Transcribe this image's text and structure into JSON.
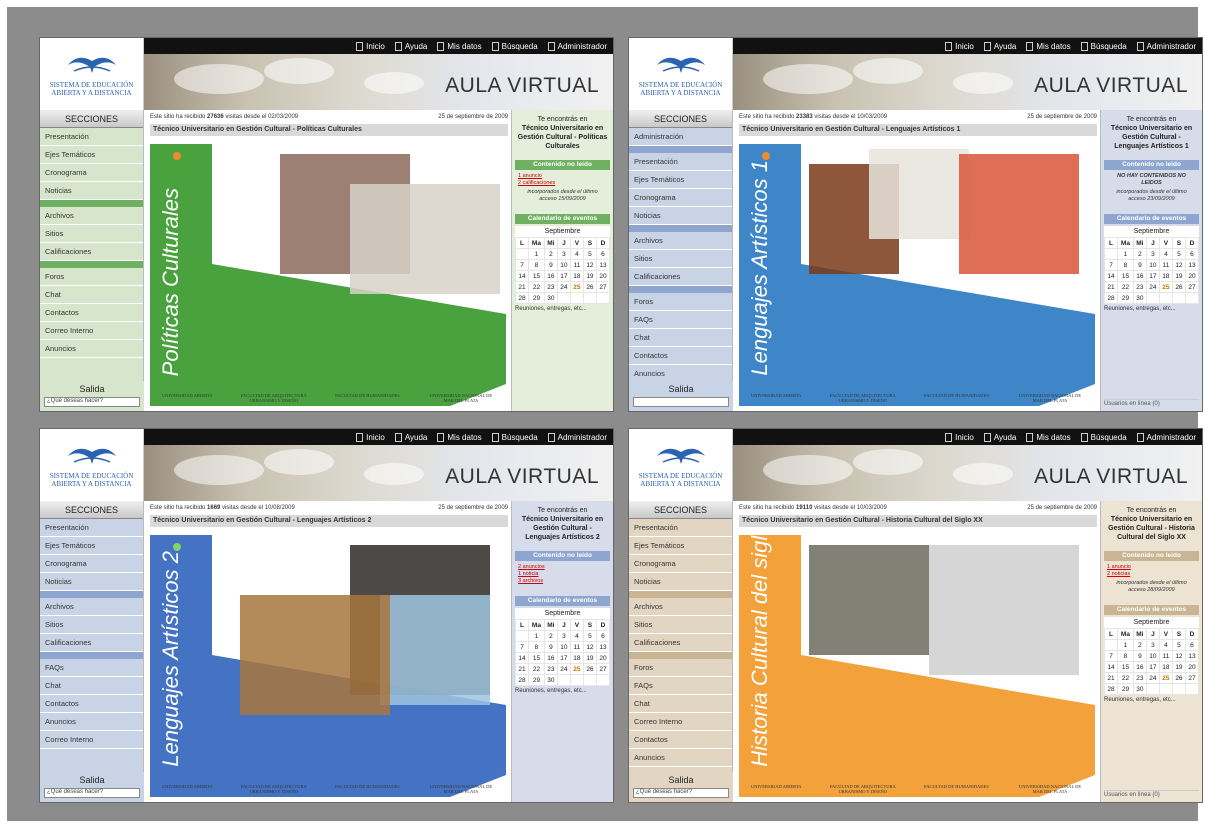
{
  "brand": {
    "logo_text": "SISTEMA DE EDUCACIÓN ABIERTA Y A DISTANCIA"
  },
  "nav": [
    {
      "label": "Inicio",
      "icon": "inicio-icon"
    },
    {
      "label": "Ayuda",
      "icon": "ayuda-icon"
    },
    {
      "label": "Mis datos",
      "icon": "mis-datos-icon"
    },
    {
      "label": "Búsqueda",
      "icon": "busqueda-icon"
    },
    {
      "label": "Administrador",
      "icon": "administrador-icon"
    }
  ],
  "banner_title": "AULA VIRTUAL",
  "partners": [
    "UNIVERSIDAD ABIERTA",
    "FACULTAD DE ARQUITECTURA URBANISMO Y DISEÑO",
    "FACULTAD DE HUMANIDADES",
    "UNIVERSIDAD NACIONAL DE MAR DEL PLATA"
  ],
  "screens": [
    {
      "theme": {
        "side_bg": "#d7e5cc",
        "right_bg": "#e4eedb",
        "accent": "#4aa23f",
        "head": "#6fb062"
      },
      "sections_head": "SECCIONES",
      "menu": [
        "Presentación",
        "Ejes Temáticos",
        "Cronograma",
        "Noticias",
        "|",
        "Archivos",
        "Sitios",
        "Calificaciones",
        "|",
        "Foros",
        "Chat",
        "Contactos",
        "Correo Interno",
        "Anuncios"
      ],
      "salida": "Salida",
      "salida_select": "¿Qué deseas hacer?",
      "visits_pre": "Este sitio ha recibido",
      "visits": "27636",
      "visits_post": "visitas desde el 02/03/2009",
      "date": "25 de septiembre de 2009",
      "crumb": "Técnico Universitario en Gestión Cultural - Políticas Culturales",
      "poster_title": "Políticas Culturales",
      "found_label": "Te encontrás en",
      "found_course": "Técnico Universitario en Gestión Cultural - Políticas Culturales",
      "unread_head": "Contenido no leído",
      "unread_links": [
        "1 anuncio",
        "2 calificaciones"
      ],
      "incorporated": "incorporados desde el último acceso 15/09/2009",
      "cal_head": "Calendario de eventos",
      "month": "Septiembre",
      "note": "Reuniones, entregas, etc...",
      "online": ""
    },
    {
      "theme": {
        "side_bg": "#c9d3e6",
        "right_bg": "#d6dcea",
        "accent": "#3f86c9",
        "head": "#8ea6cf"
      },
      "sections_head": "SECCIONES",
      "menu": [
        "Administración",
        "|",
        "Presentación",
        "Ejes Temáticos",
        "Cronograma",
        "Noticias",
        "|",
        "Archivos",
        "Sitios",
        "Calificaciones",
        "|",
        "Foros",
        "FAQs",
        "Chat",
        "Contactos",
        "Anuncios",
        "Correo Interno"
      ],
      "salida": "Salida",
      "salida_select": "",
      "visits_pre": "Este sitio ha recibido",
      "visits": "23383",
      "visits_post": "visitas desde el 10/03/2009",
      "date": "25 de septiembre de 2009",
      "crumb": "Técnico Universitario en Gestión Cultural - Lenguajes Artísticos 1",
      "poster_title": "Lenguajes Artísticos 1",
      "found_label": "Te encontrás en",
      "found_course": "Técnico Universitario en Gestión Cultural - Lenguajes Artísticos 1",
      "unread_head": "Contenido no leído",
      "unread_links": [],
      "unread_none": "NO HAY CONTENIDOS NO LEIDOS",
      "incorporated": "incorporados desde el último acceso 23/09/2009",
      "cal_head": "Calendario de eventos",
      "month": "Septiembre",
      "note": "Reuniones, entregas, etc...",
      "online": "Usuarios en línea (0)"
    },
    {
      "theme": {
        "side_bg": "#c9d3e6",
        "right_bg": "#d6dcea",
        "accent": "#4473c4",
        "head": "#8ea6cf"
      },
      "sections_head": "SECCIONES",
      "menu": [
        "Presentación",
        "Ejes Temáticos",
        "Cronograma",
        "Noticias",
        "|",
        "Archivos",
        "Sitios",
        "Calificaciones",
        "|",
        "FAQs",
        "Chat",
        "Contactos",
        "Anuncios",
        "Correo Interno"
      ],
      "salida": "Salida",
      "salida_select": "¿Qué deseas hacer?",
      "visits_pre": "Este sitio ha recibido",
      "visits": "1669",
      "visits_post": "visitas desde el 10/08/2009",
      "date": "25 de septiembre de 2009",
      "crumb": "Técnico Universitario en Gestión Cultural - Lenguajes Artísticos 2",
      "poster_title": "Lenguajes Artísticos 2",
      "found_label": "Te encontrás en",
      "found_course": "Técnico Universitario en Gestión Cultural - Lenguajes Artísticos 2",
      "unread_head": "Contenido no leído",
      "unread_links": [
        "2 anuncios",
        "1 noticia",
        "3 archivos"
      ],
      "incorporated": "",
      "cal_head": "Calendario de eventos",
      "month": "Septiembre",
      "note": "Reuniones, entregas, etc...",
      "online": ""
    },
    {
      "theme": {
        "side_bg": "#e2d6c2",
        "right_bg": "#ece3d3",
        "accent": "#f2a13b",
        "head": "#c9b493"
      },
      "sections_head": "SECCIONES",
      "menu": [
        "Presentación",
        "Ejes Temáticos",
        "Cronograma",
        "Noticias",
        "|",
        "Archivos",
        "Sitios",
        "Calificaciones",
        "|",
        "Foros",
        "FAQs",
        "Chat",
        "Correo Interno",
        "Contactos",
        "Anuncios"
      ],
      "salida": "Salida",
      "salida_select": "¿Qué deseas hacer?",
      "visits_pre": "Este sitio ha recibido",
      "visits": "19110",
      "visits_post": "visitas desde el 10/03/2009",
      "date": "25 de septiembre de 2009",
      "crumb": "Técnico Universitario en Gestión Cultural - Historia Cultural del Siglo XX",
      "poster_title": "Historia Cultural del siglo XX",
      "found_label": "Te encontrás en",
      "found_course": "Técnico Universitario en Gestión Cultural - Historia Cultural del Siglo XX",
      "unread_head": "Contenido no leído",
      "unread_links": [
        "1 anuncio",
        "2 noticias"
      ],
      "incorporated": "incorporados desde el último acceso 28/09/2009",
      "cal_head": "Calendario de eventos",
      "month": "Septiembre",
      "note": "Reuniones, entregas, etc...",
      "online": "Usuarios en línea (0)"
    }
  ],
  "calendar": {
    "days": [
      "L",
      "Ma",
      "Mi",
      "J",
      "V",
      "S",
      "D"
    ],
    "weeks": [
      [
        "",
        "1",
        "2",
        "3",
        "4",
        "5",
        "6"
      ],
      [
        "7",
        "8",
        "9",
        "10",
        "11",
        "12",
        "13"
      ],
      [
        "14",
        "15",
        "16",
        "17",
        "18",
        "19",
        "20"
      ],
      [
        "21",
        "22",
        "23",
        "24",
        "25",
        "26",
        "27"
      ],
      [
        "28",
        "29",
        "30",
        "",
        "",
        "",
        ""
      ]
    ],
    "today": "25"
  }
}
